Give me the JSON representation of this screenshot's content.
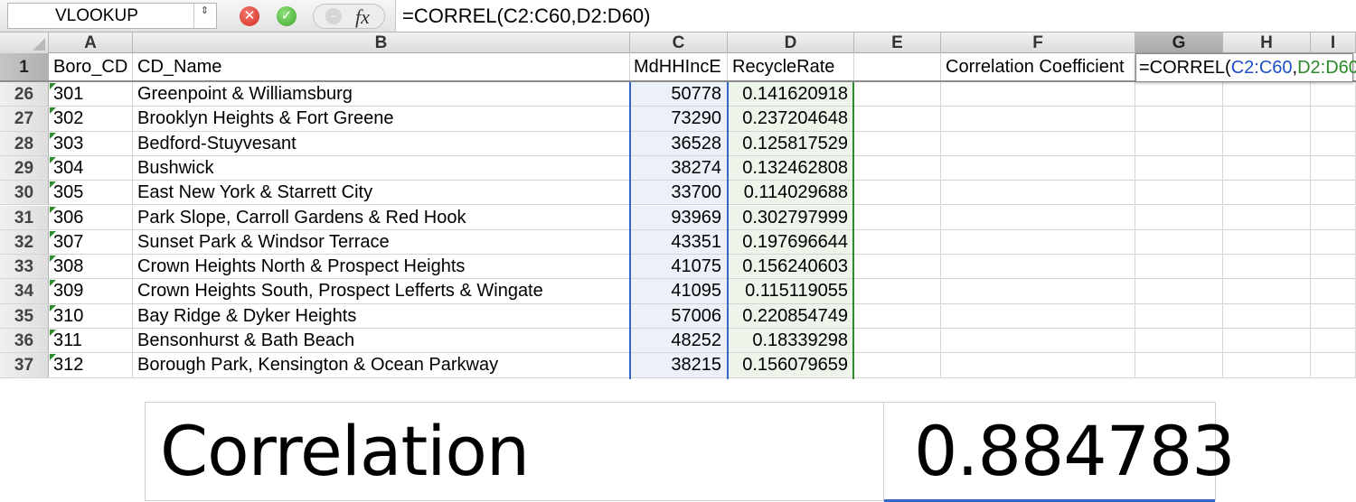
{
  "formula_bar": {
    "name_box": "VLOOKUP",
    "stepper_glyph": "⇕",
    "cancel_glyph": "✕",
    "confirm_glyph": "✓",
    "fn_glyph": "−",
    "fx_label": "fx",
    "formula": "=CORREL(C2:C60,D2:D60)"
  },
  "columns": [
    "A",
    "B",
    "C",
    "D",
    "E",
    "F",
    "G",
    "H",
    "I"
  ],
  "active_column": "G",
  "header_row": {
    "row_number": "1",
    "A": "Boro_CD",
    "B": "CD_Name",
    "C": "MdHHIncE",
    "D": "RecycleRate",
    "E": "",
    "F": "Correlation Coefficient"
  },
  "edit_cell": {
    "prefix": "=CORREL(",
    "range1": "C2:C60",
    "sep": ",",
    "range2": "D2:D60",
    "suffix": ")"
  },
  "rows": [
    {
      "n": "26",
      "a": "301",
      "b": "Greenpoint & Williamsburg",
      "c": "50778",
      "d": "0.141620918"
    },
    {
      "n": "27",
      "a": "302",
      "b": "Brooklyn Heights & Fort Greene",
      "c": "73290",
      "d": "0.237204648"
    },
    {
      "n": "28",
      "a": "303",
      "b": "Bedford-Stuyvesant",
      "c": "36528",
      "d": "0.125817529"
    },
    {
      "n": "29",
      "a": "304",
      "b": "Bushwick",
      "c": "38274",
      "d": "0.132462808"
    },
    {
      "n": "30",
      "a": "305",
      "b": "East New York & Starrett City",
      "c": "33700",
      "d": "0.114029688"
    },
    {
      "n": "31",
      "a": "306",
      "b": "Park Slope, Carroll Gardens & Red Hook",
      "c": "93969",
      "d": "0.302797999"
    },
    {
      "n": "32",
      "a": "307",
      "b": "Sunset Park & Windsor Terrace",
      "c": "43351",
      "d": "0.197696644"
    },
    {
      "n": "33",
      "a": "308",
      "b": "Crown Heights North & Prospect Heights",
      "c": "41075",
      "d": "0.156240603"
    },
    {
      "n": "34",
      "a": "309",
      "b": "Crown Heights South, Prospect Lefferts & Wingate",
      "c": "41095",
      "d": "0.115119055"
    },
    {
      "n": "35",
      "a": "310",
      "b": "Bay Ridge & Dyker Heights",
      "c": "57006",
      "d": "0.220854749"
    },
    {
      "n": "36",
      "a": "311",
      "b": "Bensonhurst & Bath Beach",
      "c": "48252",
      "d": "0.18339298"
    },
    {
      "n": "37",
      "a": "312",
      "b": "Borough Park, Kensington & Ocean Parkway",
      "c": "38215",
      "d": "0.156079659"
    }
  ],
  "result": {
    "label": "Correlation Coefficient",
    "value": "0.884783"
  },
  "colors": {
    "range1": "#1f4fc7",
    "range2": "#2a8a2a"
  }
}
